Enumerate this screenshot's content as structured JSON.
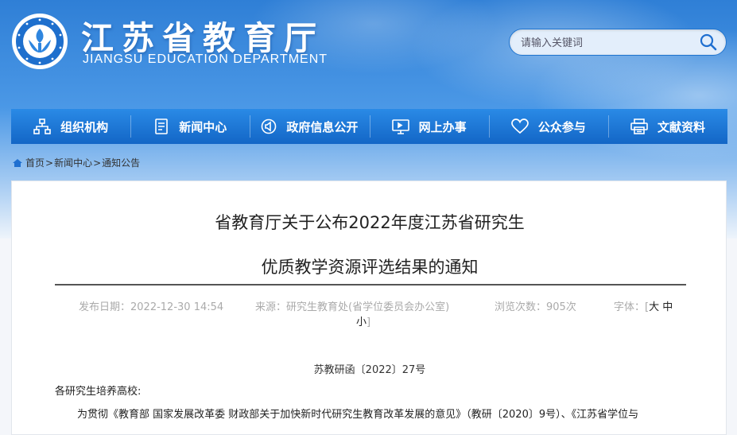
{
  "header": {
    "title_cn": "江苏省教育厅",
    "title_en": "JIANGSU EDUCATION DEPARTMENT",
    "search_placeholder": "请输入关键词"
  },
  "nav": {
    "items": [
      {
        "label": "组织机构",
        "icon": "org-chart-icon"
      },
      {
        "label": "新闻中心",
        "icon": "document-icon"
      },
      {
        "label": "政府信息公开",
        "icon": "announce-icon"
      },
      {
        "label": "网上办事",
        "icon": "monitor-icon"
      },
      {
        "label": "公众参与",
        "icon": "heart-icon"
      },
      {
        "label": "文献资料",
        "icon": "printer-icon"
      }
    ]
  },
  "breadcrumb": {
    "home": "首页",
    "news": "新闻中心",
    "notice": "通知公告",
    "sep": ">"
  },
  "article": {
    "title_line1": "省教育厅关于公布2022年度江苏省研究生",
    "title_line2": "优质教学资源评选结果的通知",
    "meta": {
      "date_label": "发布日期：",
      "date": "2022-12-30 14:54",
      "source_label": "来源：",
      "source": "研究生教育处(省学位委员会办公室)",
      "views_label": "浏览次数：",
      "views": "905次",
      "font_label": "字体：",
      "font_large": "大",
      "font_medium": "中",
      "font_small": "小"
    },
    "doc_number": "苏教研函〔2022〕27号",
    "salutation": "各研究生培养高校:",
    "body_start": "为贯彻《教育部 国家发展改革委 财政部关于加快新时代研究生教育改革发展的意见》（教研〔2020〕9号）、《江苏省学位与"
  },
  "colors": {
    "nav_blue": "#1b78d8",
    "sky_blue": "#3f8fe0"
  }
}
